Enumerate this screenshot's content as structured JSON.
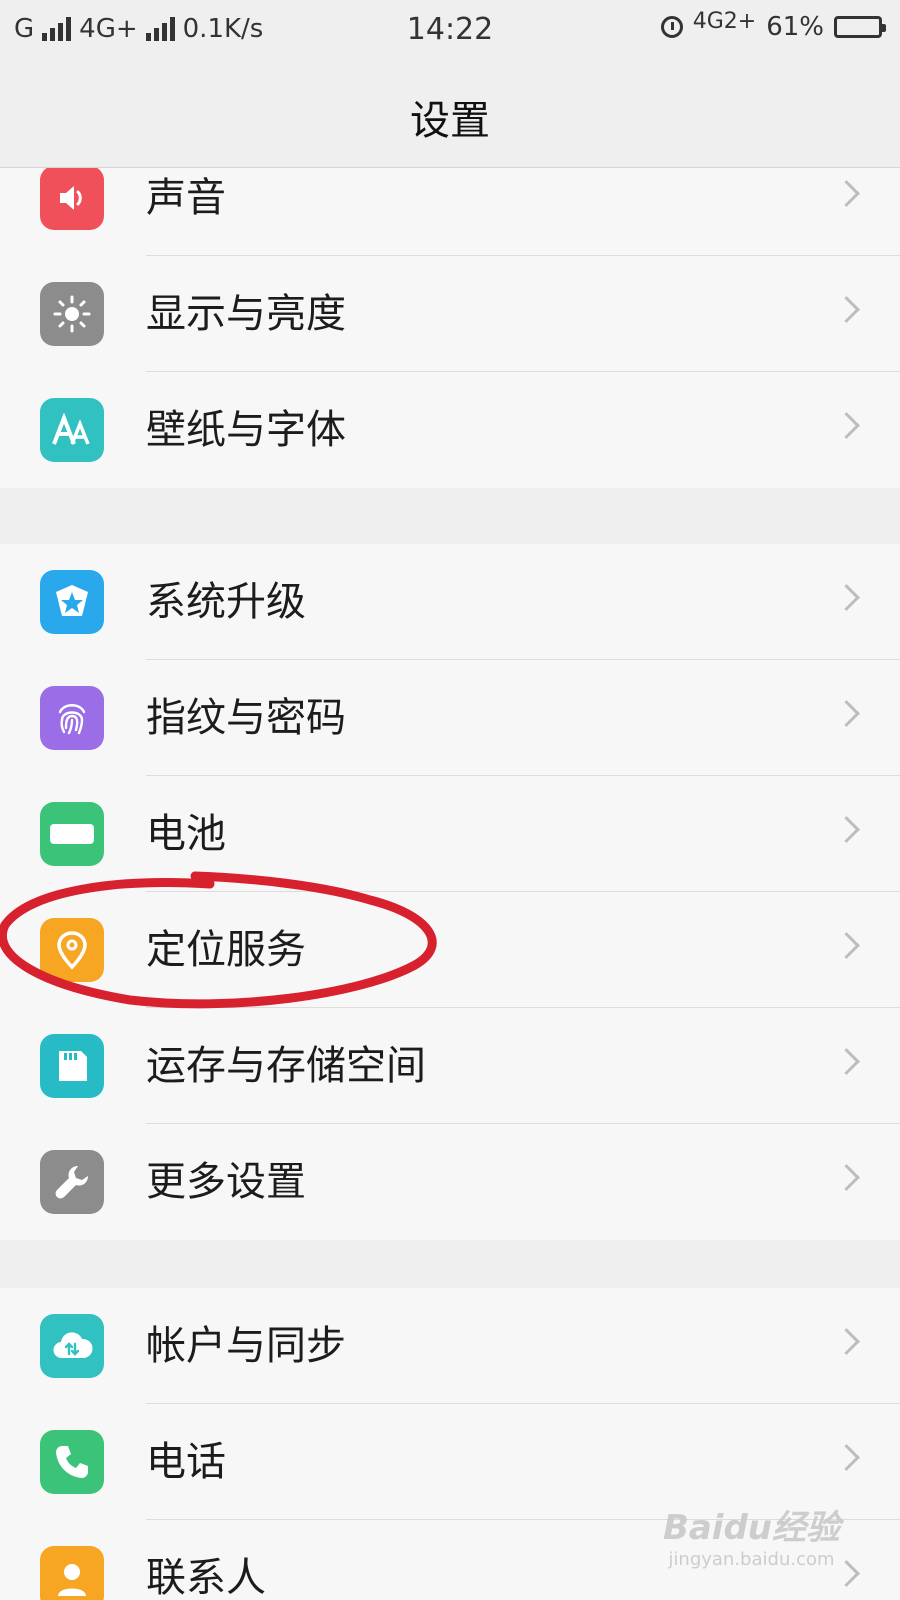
{
  "status_bar": {
    "carrier1": "G",
    "net1": "4G+",
    "speed": "0.1K/s",
    "time": "14:22",
    "net2": "4G2+",
    "battery": "61%",
    "battery_level": 0.61,
    "battery_color": "#f4c20d"
  },
  "title": "设置",
  "groups": [
    {
      "items": [
        {
          "label": "声音",
          "icon": "speaker-icon",
          "color": "#f0505a"
        },
        {
          "label": "显示与亮度",
          "icon": "brightness-icon",
          "color": "#8c8c8c"
        },
        {
          "label": "壁纸与字体",
          "icon": "font-icon",
          "color": "#31c1c0"
        }
      ]
    },
    {
      "items": [
        {
          "label": "系统升级",
          "icon": "upgrade-icon",
          "color": "#2aa8ec"
        },
        {
          "label": "指纹与密码",
          "icon": "fingerprint-icon",
          "color": "#9b6ee8"
        },
        {
          "label": "电池",
          "icon": "battery-icon",
          "color": "#3cc37a"
        },
        {
          "label": "定位服务",
          "icon": "location-pin-icon",
          "color": "#f6a623"
        },
        {
          "label": "运存与存储空间",
          "icon": "sd-card-icon",
          "color": "#27bcc5"
        },
        {
          "label": "更多设置",
          "icon": "wrench-icon",
          "color": "#8c8c8c"
        }
      ]
    },
    {
      "items": [
        {
          "label": "帐户与同步",
          "icon": "cloud-sync-icon",
          "color": "#31c1c0"
        },
        {
          "label": "电话",
          "icon": "phone-icon",
          "color": "#3cc37a"
        },
        {
          "label": "联系人",
          "icon": "contact-icon",
          "color": "#f6a623"
        }
      ]
    }
  ],
  "annotation_color": "#d8212e",
  "watermark": {
    "logo": "Baidu经验",
    "url": "jingyan.baidu.com"
  }
}
